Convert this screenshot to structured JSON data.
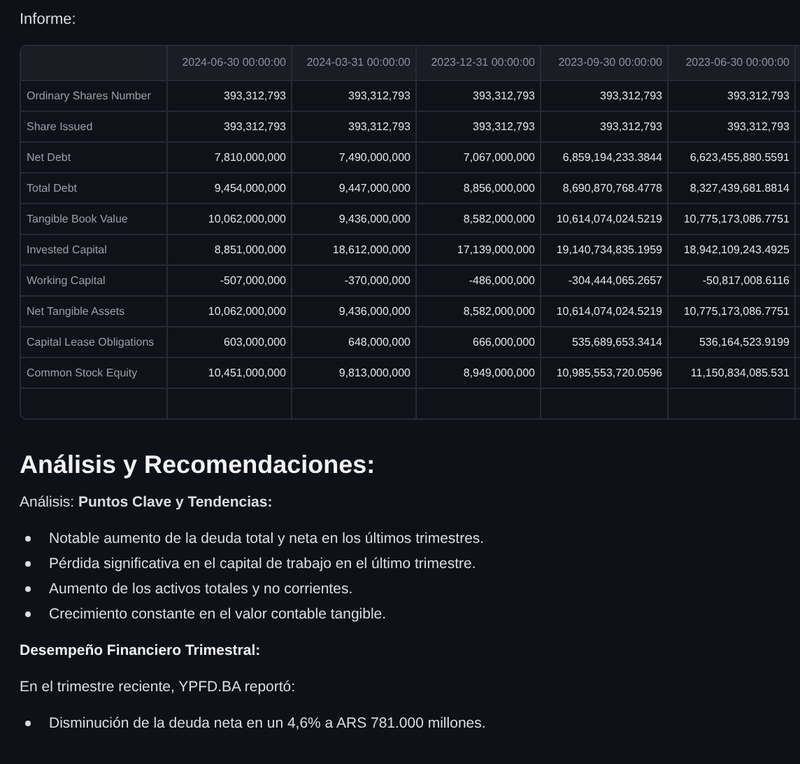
{
  "report_label": "Informe:",
  "table": {
    "columns": [
      "2024-06-30 00:00:00",
      "2024-03-31 00:00:00",
      "2023-12-31 00:00:00",
      "2023-09-30 00:00:00",
      "2023-06-30 00:00:00"
    ],
    "rows": [
      {
        "label": "Ordinary Shares Number",
        "values": [
          "393,312,793",
          "393,312,793",
          "393,312,793",
          "393,312,793",
          "393,312,793"
        ]
      },
      {
        "label": "Share Issued",
        "values": [
          "393,312,793",
          "393,312,793",
          "393,312,793",
          "393,312,793",
          "393,312,793"
        ]
      },
      {
        "label": "Net Debt",
        "values": [
          "7,810,000,000",
          "7,490,000,000",
          "7,067,000,000",
          "6,859,194,233.3844",
          "6,623,455,880.5591"
        ]
      },
      {
        "label": "Total Debt",
        "values": [
          "9,454,000,000",
          "9,447,000,000",
          "8,856,000,000",
          "8,690,870,768.4778",
          "8,327,439,681.8814"
        ]
      },
      {
        "label": "Tangible Book Value",
        "values": [
          "10,062,000,000",
          "9,436,000,000",
          "8,582,000,000",
          "10,614,074,024.5219",
          "10,775,173,086.7751"
        ]
      },
      {
        "label": "Invested Capital",
        "values": [
          "8,851,000,000",
          "18,612,000,000",
          "17,139,000,000",
          "19,140,734,835.1959",
          "18,942,109,243.4925"
        ]
      },
      {
        "label": "Working Capital",
        "values": [
          "-507,000,000",
          "-370,000,000",
          "-486,000,000",
          "-304,444,065.2657",
          "-50,817,008.6116"
        ]
      },
      {
        "label": "Net Tangible Assets",
        "values": [
          "10,062,000,000",
          "9,436,000,000",
          "8,582,000,000",
          "10,614,074,024.5219",
          "10,775,173,086.7751"
        ]
      },
      {
        "label": "Capital Lease Obligations",
        "values": [
          "603,000,000",
          "648,000,000",
          "666,000,000",
          "535,689,653.3414",
          "536,164,523.9199"
        ]
      },
      {
        "label": "Common Stock Equity",
        "values": [
          "10,451,000,000",
          "9,813,000,000",
          "8,949,000,000",
          "10,985,553,720.0596",
          "11,150,834,085.531"
        ]
      }
    ]
  },
  "analysis": {
    "heading": "Análisis y Recomendaciones:",
    "blocks": [
      {
        "kind": "paragraph",
        "text": "Análisis: **Puntos Clave y Tendencias:**"
      },
      {
        "kind": "list",
        "items": [
          "Notable aumento de la deuda total y neta en los últimos trimestres.",
          "Pérdida significativa en el capital de trabajo en el último trimestre.",
          "Aumento de los activos totales y no corrientes.",
          "Crecimiento constante en el valor contable tangible."
        ]
      },
      {
        "kind": "subheading",
        "text": "Desempeño Financiero Trimestral:"
      },
      {
        "kind": "paragraph",
        "text": "En el trimestre reciente, YPFD.BA reportó:"
      },
      {
        "kind": "list",
        "items": [
          "Disminución de la deuda neta en un 4,6% a ARS 781.000 millones."
        ]
      }
    ]
  }
}
